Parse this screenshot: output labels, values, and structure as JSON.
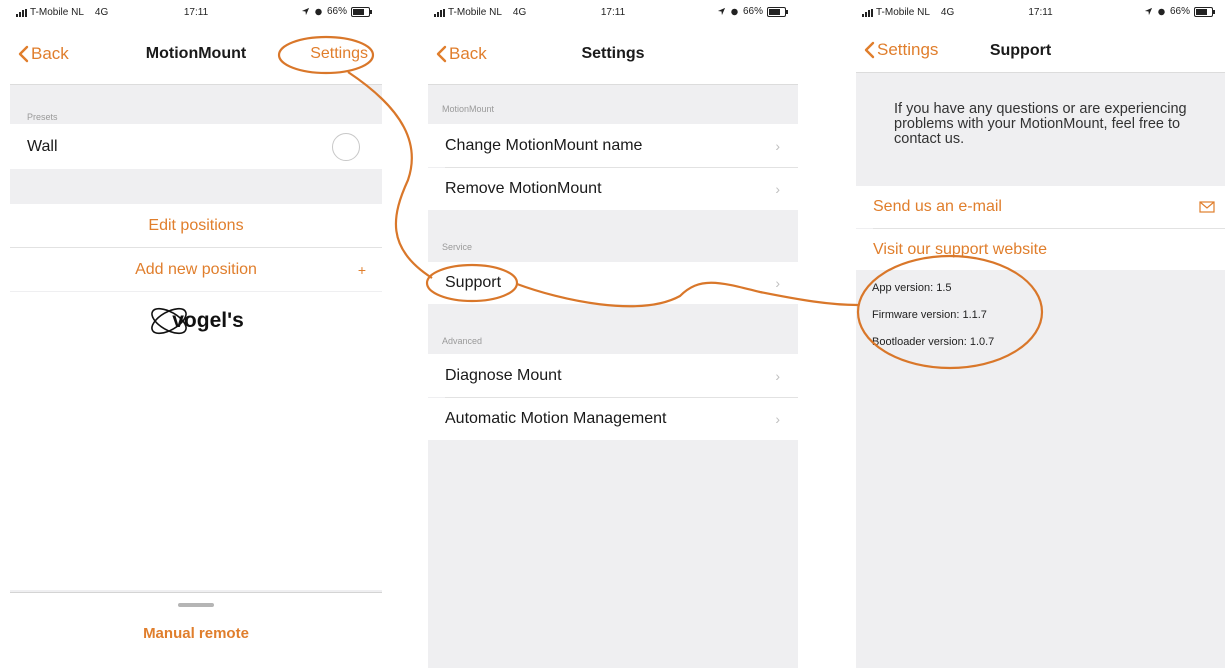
{
  "status": {
    "carrier": "T-Mobile NL",
    "network": "4G",
    "time": "17:11",
    "battery": "66%"
  },
  "screen1": {
    "back": "Back",
    "title": "MotionMount",
    "settings": "Settings",
    "presets_label": "Presets",
    "preset_wall": "Wall",
    "edit_positions": "Edit positions",
    "add_new_position": "Add new position",
    "add_symbol": "+",
    "logo_text": "vogel's",
    "manual_remote": "Manual remote"
  },
  "screen2": {
    "back": "Back",
    "title": "Settings",
    "sections": [
      {
        "label": "MotionMount",
        "items": [
          "Change MotionMount name",
          "Remove MotionMount"
        ]
      },
      {
        "label": "Service",
        "items": [
          "Support"
        ]
      },
      {
        "label": "Advanced",
        "items": [
          "Diagnose Mount",
          "Automatic Motion Management"
        ]
      }
    ]
  },
  "screen3": {
    "back": "Settings",
    "title": "Support",
    "intro": "If you have any questions or are experiencing problems with your MotionMount, feel free to contact us.",
    "send_email": "Send us an e-mail",
    "visit_website": "Visit our support website",
    "app_version": "App version: 1.5",
    "firmware_version": "Firmware version: 1.1.7",
    "bootloader_version": "Bootloader version: 1.0.7"
  },
  "colors": {
    "accent": "#e07e2c",
    "background": "#efeff1",
    "row": "#ffffff"
  },
  "icons": [
    "signal-bars-icon",
    "location-arrow-icon",
    "alarm-icon",
    "battery-icon",
    "chevron-left-icon",
    "chevron-right-icon",
    "envelope-icon",
    "vogels-logo-icon"
  ]
}
